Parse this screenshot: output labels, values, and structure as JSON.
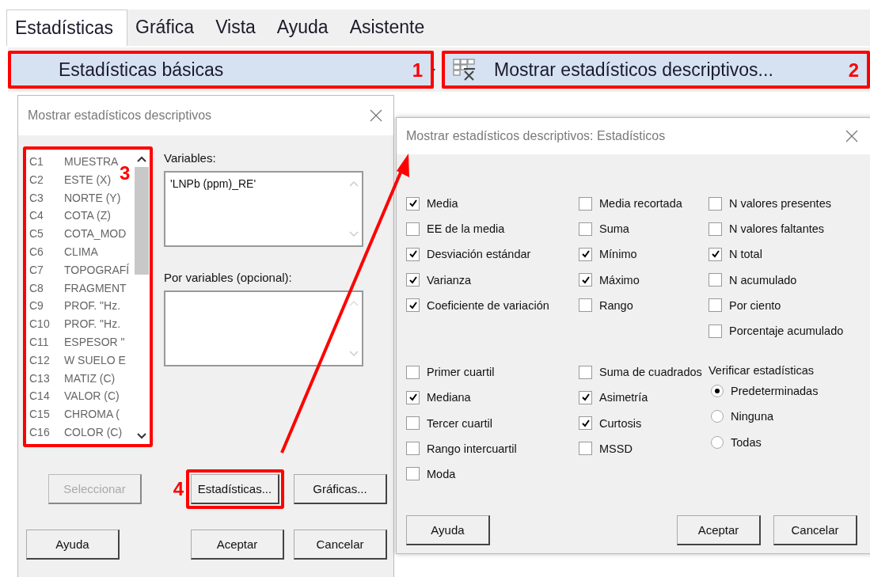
{
  "menu_bar": [
    {
      "label": "Estadísticas",
      "selected": true
    },
    {
      "label": "Gráfica",
      "selected": false
    },
    {
      "label": "Vista",
      "selected": false
    },
    {
      "label": "Ayuda",
      "selected": false
    },
    {
      "label": "Asistente",
      "selected": false
    }
  ],
  "submenu": [
    {
      "kind": "submenu",
      "label": "Estadísticas básicas",
      "callout": "1",
      "selected": true
    },
    {
      "kind": "command",
      "label": "Mostrar estadísticos descriptivos...",
      "callout": "2",
      "selected": true
    }
  ],
  "main_dialog": {
    "title": "Mostrar estadísticos descriptivos",
    "columns_callout": "3",
    "columns": [
      {
        "id": "C1",
        "name": "MUESTRA"
      },
      {
        "id": "C2",
        "name": "ESTE (X)"
      },
      {
        "id": "C3",
        "name": "NORTE (Y)"
      },
      {
        "id": "C4",
        "name": "COTA (Z)"
      },
      {
        "id": "C5",
        "name": "COTA_MOD"
      },
      {
        "id": "C6",
        "name": "CLIMA"
      },
      {
        "id": "C7",
        "name": "TOPOGRAFÍ"
      },
      {
        "id": "C8",
        "name": "FRAGMENT"
      },
      {
        "id": "C9",
        "name": "PROF. \"Hz."
      },
      {
        "id": "C10",
        "name": "PROF. \"Hz."
      },
      {
        "id": "C11",
        "name": "ESPESOR \""
      },
      {
        "id": "C12",
        "name": "W SUELO E"
      },
      {
        "id": "C13",
        "name": "MATIZ (C)"
      },
      {
        "id": "C14",
        "name": "VALOR (C)"
      },
      {
        "id": "C15",
        "name": "CHROMA ("
      },
      {
        "id": "C16",
        "name": "COLOR (C)"
      }
    ],
    "variables": {
      "label": "Variables:",
      "value": "'LNPb (ppm)_RE'"
    },
    "by_variables": {
      "label": "Por variables (opcional):"
    },
    "buttons": [
      {
        "label": "Seleccionar",
        "disabled": true
      },
      {
        "label": "Estadísticas...",
        "disabled": false,
        "callout": "4"
      },
      {
        "label": "Gráficas...",
        "disabled": false
      },
      {
        "label": "Ayuda",
        "disabled": false
      },
      {
        "label": "Aceptar",
        "disabled": false
      },
      {
        "label": "Cancelar",
        "disabled": false
      }
    ]
  },
  "stats_dialog": {
    "title": "Mostrar estadísticos descriptivos: Estadísticos",
    "upper_columns": [
      [
        {
          "label": "Media",
          "checked": true
        },
        {
          "label": "EE de la media",
          "checked": false
        },
        {
          "label": "Desviación estándar",
          "checked": true
        },
        {
          "label": "Varianza",
          "checked": true
        },
        {
          "label": "Coeficiente de variación",
          "checked": true
        }
      ],
      [
        {
          "label": "Media recortada",
          "checked": false
        },
        {
          "label": "Suma",
          "checked": false
        },
        {
          "label": "Mínimo",
          "checked": true
        },
        {
          "label": "Máximo",
          "checked": true
        },
        {
          "label": "Rango",
          "checked": false
        }
      ],
      [
        {
          "label": "N valores presentes",
          "checked": false
        },
        {
          "label": "N valores faltantes",
          "checked": false
        },
        {
          "label": "N total",
          "checked": true
        },
        {
          "label": "N acumulado",
          "checked": false
        },
        {
          "label": "Por ciento",
          "checked": false
        },
        {
          "label": "Porcentaje acumulado",
          "checked": false
        }
      ]
    ],
    "lower_columns": [
      [
        {
          "label": "Primer cuartil",
          "checked": false
        },
        {
          "label": "Mediana",
          "checked": true
        },
        {
          "label": "Tercer cuartil",
          "checked": false
        },
        {
          "label": "Rango intercuartil",
          "checked": false
        },
        {
          "label": "Moda",
          "checked": false
        }
      ],
      [
        {
          "label": "Suma de cuadrados",
          "checked": false
        },
        {
          "label": "Asimetría",
          "checked": true
        },
        {
          "label": "Curtosis",
          "checked": true
        },
        {
          "label": "MSSD",
          "checked": false
        }
      ]
    ],
    "verify": {
      "title": "Verificar estadísticas",
      "options": [
        {
          "label": "Predeterminadas",
          "selected": true
        },
        {
          "label": "Ninguna",
          "selected": false
        },
        {
          "label": "Todas",
          "selected": false
        }
      ]
    },
    "buttons": [
      {
        "label": "Ayuda"
      },
      {
        "label": "Aceptar"
      },
      {
        "label": "Cancelar"
      }
    ]
  }
}
